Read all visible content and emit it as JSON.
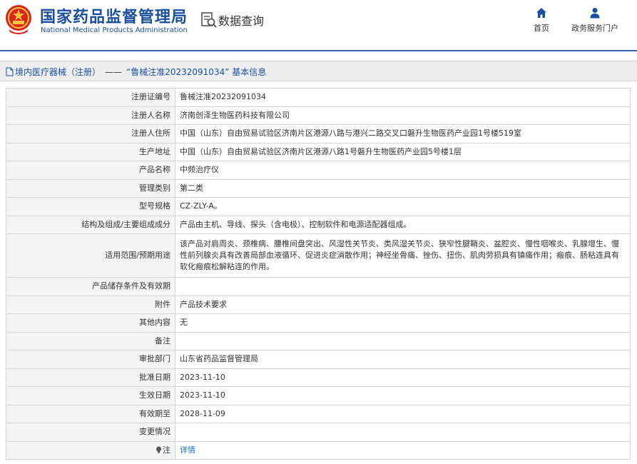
{
  "header": {
    "brand_cn": "国家药品监督管理局",
    "brand_en": "National Medical Products Administration",
    "site_title": "数据查询",
    "nav": [
      {
        "label": "首页",
        "icon": "home-icon"
      },
      {
        "label": "政务服务门户",
        "icon": "user-icon"
      }
    ]
  },
  "breadcrumb": {
    "category": "境内医疗器械（注册）",
    "separator": "——",
    "current": "“鲁械注准20232091034” 基本信息"
  },
  "details": [
    {
      "label": "注册证编号",
      "value": "鲁械注准20232091034"
    },
    {
      "label": "注册人名称",
      "value": "济南创泽生物医药科技有限公司"
    },
    {
      "label": "注册人住所",
      "value": "中国（山东）自由贸易试验区济南片区港源八路与港兴二路交叉口磐升生物医药产业园1号楼519室"
    },
    {
      "label": "生产地址",
      "value": "中国（山东）自由贸易试验区济南片区港源八路1号磐升生物医药产业园5号楼1层"
    },
    {
      "label": "产品名称",
      "value": "中频治疗仪"
    },
    {
      "label": "管理类别",
      "value": "第二类"
    },
    {
      "label": "型号规格",
      "value": "CZ-ZLY-A。"
    },
    {
      "label": "结构及组成/主要组成成分",
      "value": "产品由主机、导线、探头（含电极）、控制软件和电源适配器组成。"
    },
    {
      "label": "适用范围/预期用途",
      "value": "该产品对肩周炎、颈椎病、腰椎间盘突出、风湿性关节炎、类风湿关节炎、狭窄性腱鞘炎、盆腔炎、慢性咽喉炎、乳腺增生、慢性前列腺炎具有改善局部血液循环、促进炎症消散作用；神经坐骨痛、挫伤、扭伤、肌肉劳损具有镇痛作用；瘢痕、肠粘连具有软化瘢痕松解粘连的作用。"
    },
    {
      "label": "产品储存条件及有效期",
      "value": ""
    },
    {
      "label": "附件",
      "value": "产品技术要求"
    },
    {
      "label": "其他内容",
      "value": "无"
    },
    {
      "label": "备注",
      "value": ""
    },
    {
      "label": "审批部门",
      "value": "山东省药品监督管理局"
    },
    {
      "label": "批准日期",
      "value": "2023-11-10"
    },
    {
      "label": "生效日期",
      "value": "2023-11-10"
    },
    {
      "label": "有效期至",
      "value": "2028-11-09"
    },
    {
      "label": "变更情况",
      "value": ""
    },
    {
      "label": "注",
      "value": "详情",
      "icon": "lightbulb-icon"
    }
  ],
  "colors": {
    "brand_blue": "#1a4fa0",
    "emblem_red": "#d9261c",
    "emblem_gold": "#f6c343",
    "link_blue": "#1a73c8"
  }
}
